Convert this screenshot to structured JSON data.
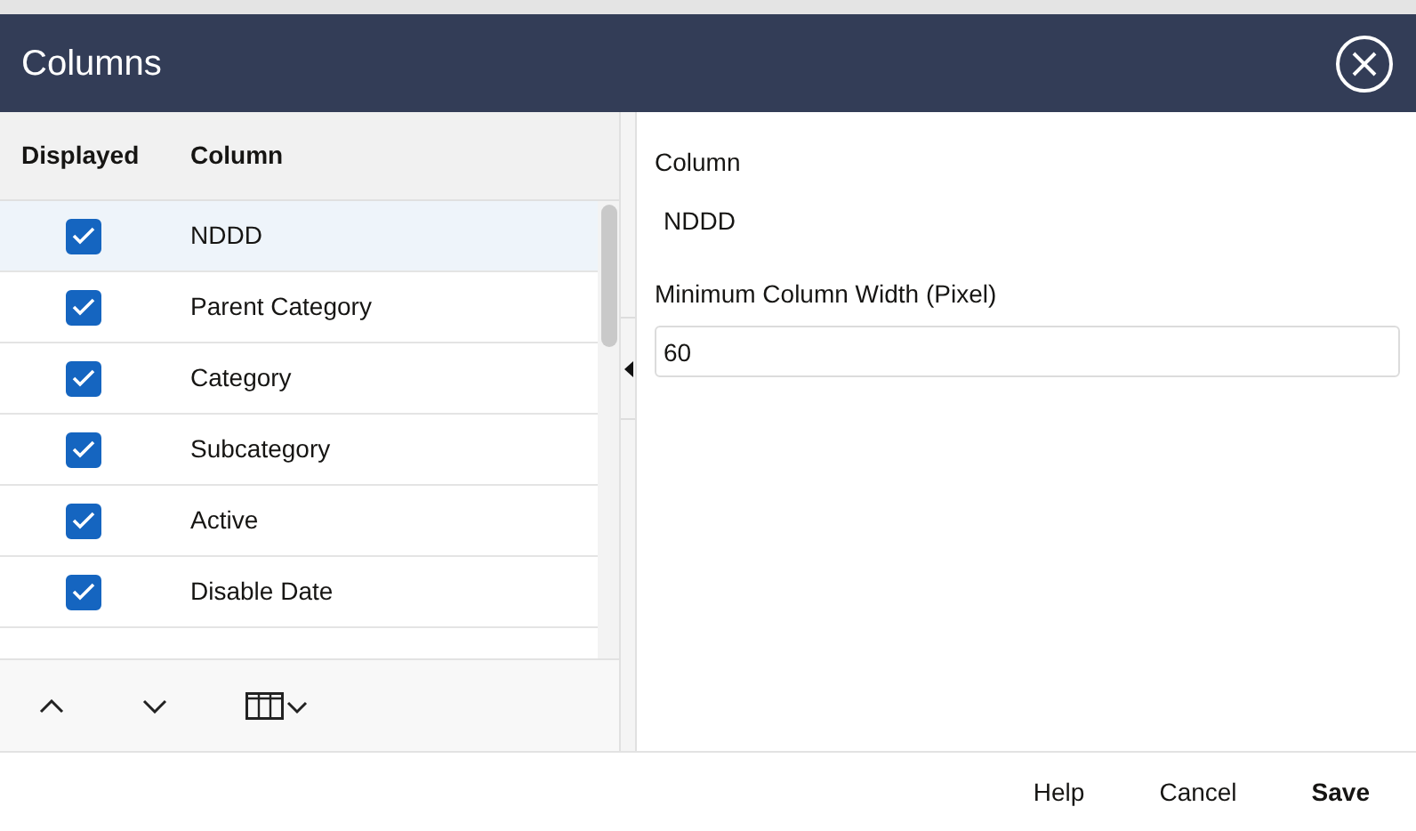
{
  "dialog": {
    "title": "Columns"
  },
  "list": {
    "columns": [
      "Displayed",
      "Column"
    ],
    "rows": [
      {
        "label": "NDDD",
        "checked": true,
        "selected": true
      },
      {
        "label": "Parent Category",
        "checked": true,
        "selected": false
      },
      {
        "label": "Category",
        "checked": true,
        "selected": false
      },
      {
        "label": "Subcategory",
        "checked": true,
        "selected": false
      },
      {
        "label": "Active",
        "checked": true,
        "selected": false
      },
      {
        "label": "Disable Date",
        "checked": true,
        "selected": false
      }
    ]
  },
  "details": {
    "column_label": "Column",
    "column_value": "NDDD",
    "width_label": "Minimum Column Width (Pixel)",
    "width_value": "60"
  },
  "footer": {
    "buttons": [
      {
        "label": "Help",
        "kind": "plain"
      },
      {
        "label": "Cancel",
        "kind": "plain"
      },
      {
        "label": "Save",
        "kind": "primary"
      }
    ]
  }
}
